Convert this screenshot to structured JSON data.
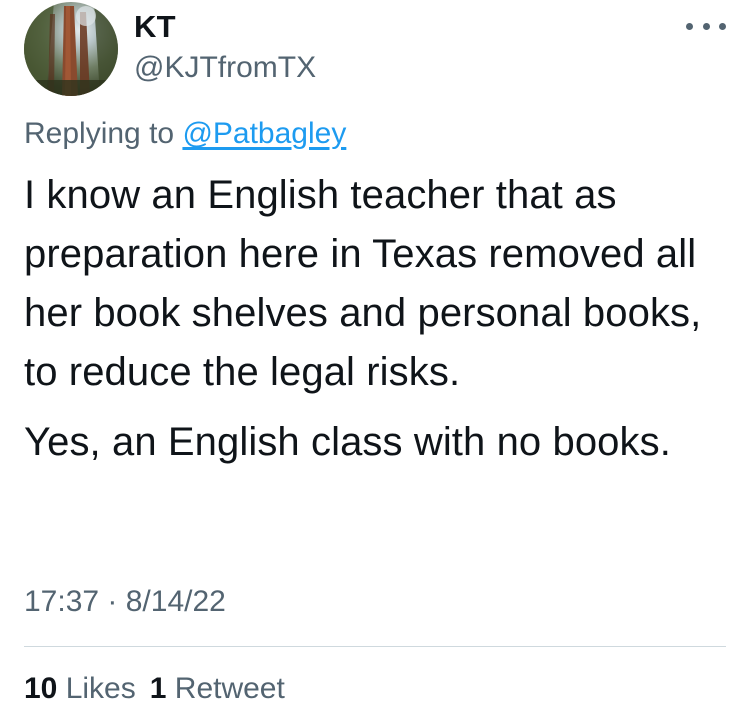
{
  "author": {
    "display_name": "KT",
    "handle": "@KJTfromTX",
    "avatar_icon": "redwood-trees-avatar"
  },
  "reply": {
    "prefix": "Replying to ",
    "mention": "@Patbagley"
  },
  "tweet": {
    "paragraphs": [
      "I know an English teacher that as preparation here in Texas removed all her book shelves and personal books, to reduce the legal risks.",
      "Yes, an English class with no books."
    ]
  },
  "meta": {
    "timestamp": "17:37 · 8/14/22"
  },
  "stats": {
    "likes_count": "10",
    "likes_label": " Likes",
    "retweets_count": "1",
    "retweets_label": " Retweet"
  },
  "colors": {
    "text": "#0f1419",
    "secondary": "#536471",
    "link": "#1d9bf0",
    "divider": "#cfd9de"
  },
  "icons": {
    "more": "more-horizontal-icon"
  }
}
